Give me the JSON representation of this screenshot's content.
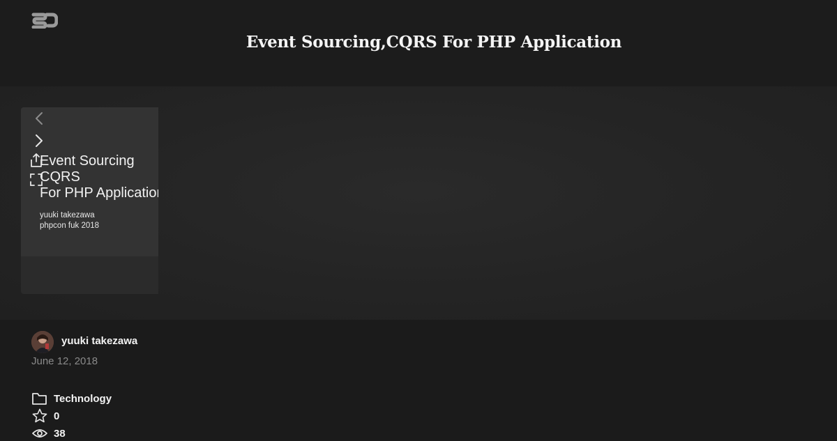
{
  "header": {
    "logo_text": "SD",
    "title": "Event Sourcing,CQRS For PHP Application"
  },
  "slide": {
    "heading": "Event Sourcing\nCQRS\nFor PHP Application",
    "subtitle": "yuuki takezawa\nphpcon fuk 2018"
  },
  "controls": {
    "prev_icon": "chevron-left-icon",
    "next_icon": "chevron-right-icon",
    "share_icon": "share-icon",
    "fullscreen_icon": "fullscreen-icon"
  },
  "author": {
    "name": "yuuki takezawa",
    "date": "June 12, 2018"
  },
  "stats": {
    "category": "Technology",
    "stars": "0",
    "views": "38"
  },
  "colors": {
    "background": "#1b1b1b",
    "stage": "#242424",
    "slide": "#333333",
    "muted_text": "#8a8a8a"
  }
}
